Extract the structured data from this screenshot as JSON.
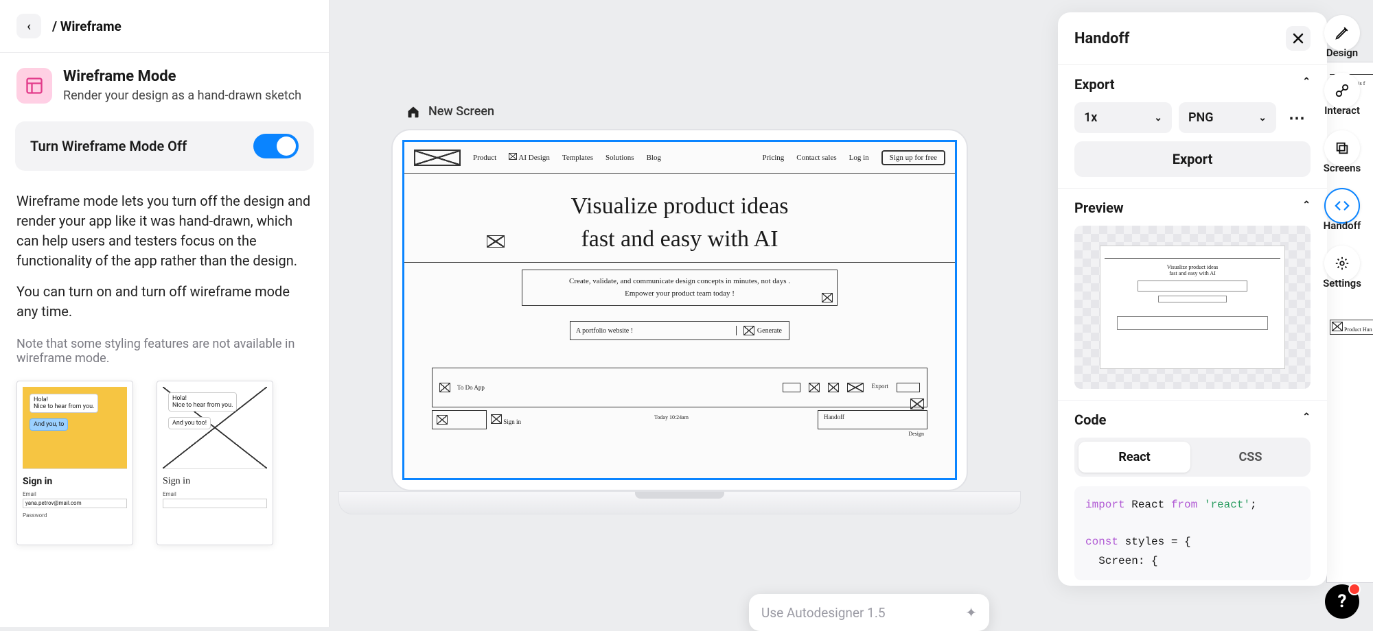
{
  "header": {
    "breadcrumb": "/ Wireframe"
  },
  "mode": {
    "title": "Wireframe Mode",
    "description": "Render your design as a hand-drawn sketch"
  },
  "toggle": {
    "label": "Turn Wireframe Mode Off"
  },
  "explain": {
    "p1": "Wireframe mode lets you turn off the design and render your app like it was hand-drawn, which can help users and testers focus on the functionality of the app rather than the design.",
    "p2": "You can turn on and turn off wireframe mode any time."
  },
  "note": "Note that some styling features are not available in wireframe mode.",
  "thumbs": {
    "a": {
      "hola": "Hola!",
      "nice": "Nice to hear from you.",
      "you": "And you, to",
      "signin": "Sign in",
      "email_label": "Email",
      "email_value": "yana.petrov@mail.com",
      "pw_label": "Password"
    },
    "b": {
      "hola": "Hola!",
      "nice": "Nice to hear from you.",
      "you": "And you too!",
      "signin": "Sign in",
      "email_label": "Email"
    }
  },
  "canvas": {
    "home_label": "New Screen",
    "wireframe": {
      "nav": [
        "Product",
        "AI Design",
        "Templates",
        "Solutions",
        "Blog",
        "Pricing",
        "Contact sales",
        "Log in",
        "Sign up for free"
      ],
      "hero1": "Visualize product ideas",
      "hero2": "fast and easy with AI",
      "sub1": "Create, validate, and communicate design concepts in minutes, not days .",
      "sub2": "Empower your product team today !",
      "input_value": "A portfolio website !",
      "generate": "Generate",
      "app_title": "To Do App",
      "lower_left": "Sign in",
      "lower_right": "Handoff",
      "lower_far": "Design",
      "export_label": "Export",
      "today": "Today 10:24am"
    }
  },
  "handoff": {
    "title": "Handoff",
    "export": {
      "title": "Export",
      "scale": "1x",
      "format": "PNG",
      "button": "Export"
    },
    "preview": {
      "title": "Preview",
      "hero1": "Visualize product ideas",
      "hero2": "fast and easy with AI"
    },
    "code": {
      "title": "Code",
      "tab_react": "React",
      "tab_css": "CSS",
      "l1a": "import",
      "l1b": " React ",
      "l1c": "from",
      "l1d": " 'react'",
      "l1e": ";",
      "l2a": "const",
      "l2b": " styles = {",
      "l3": "  Screen: {"
    }
  },
  "rail": {
    "design": "Design",
    "interact": "Interact",
    "screens": "Screens",
    "handoff": "Handoff",
    "settings": "Settings"
  },
  "autodesigner": {
    "placeholder": "Use Autodesigner 1.5"
  },
  "bgpeek": {
    "t1": "design is f",
    "ph": "Product Hun"
  }
}
